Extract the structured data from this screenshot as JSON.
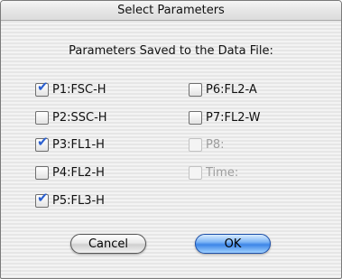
{
  "dialog": {
    "title": "Select Parameters",
    "heading": "Parameters Saved to the Data File:",
    "parameters": [
      {
        "label": "P1:FSC-H",
        "checked": true,
        "enabled": true
      },
      {
        "label": "P2:SSC-H",
        "checked": false,
        "enabled": true
      },
      {
        "label": "P3:FL1-H",
        "checked": true,
        "enabled": true
      },
      {
        "label": "P4:FL2-H",
        "checked": false,
        "enabled": true
      },
      {
        "label": "P5:FL3-H",
        "checked": true,
        "enabled": true
      },
      {
        "label": "P6:FL2-A",
        "checked": false,
        "enabled": true
      },
      {
        "label": "P7:FL2-W",
        "checked": false,
        "enabled": true
      },
      {
        "label": "P8:",
        "checked": false,
        "enabled": false
      },
      {
        "label": "Time:",
        "checked": false,
        "enabled": false
      }
    ],
    "buttons": {
      "cancel": "Cancel",
      "ok": "OK"
    },
    "checkmark": "✔"
  }
}
